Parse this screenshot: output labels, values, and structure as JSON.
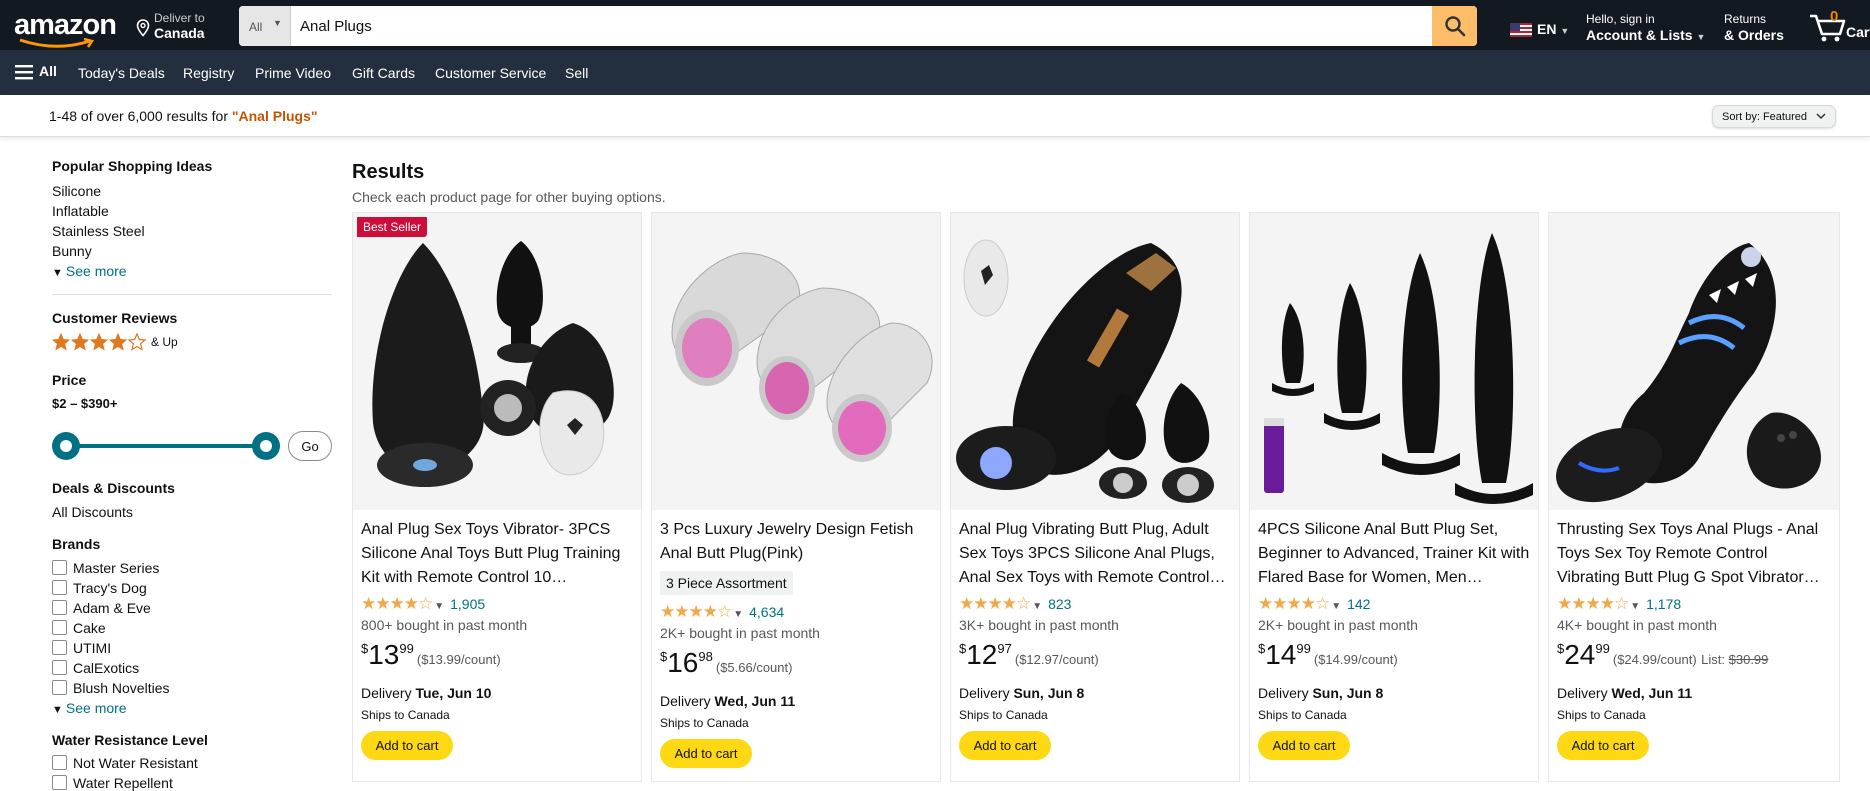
{
  "header": {
    "deliver_line1": "Deliver to",
    "deliver_line2": "Canada",
    "search_category": "All",
    "search_query": "Anal Plugs",
    "language": "EN",
    "account_line1": "Hello, sign in",
    "account_line2": "Account & Lists",
    "orders_line1": "Returns",
    "orders_line2": "& Orders",
    "cart_count": "0",
    "cart_label": "Cart"
  },
  "subnav": {
    "all_label": "All",
    "items": [
      "Today's Deals",
      "Registry",
      "Prime Video",
      "Gift Cards",
      "Customer Service",
      "Sell"
    ]
  },
  "results_bar": {
    "count_text": "1-48 of over 6,000 results for ",
    "query": "\"Anal Plugs\"",
    "sort_label": "Sort by:  Featured"
  },
  "sidebar": {
    "popular_heading": "Popular Shopping Ideas",
    "popular_items": [
      "Silicone",
      "Inflatable",
      "Stainless Steel",
      "Bunny"
    ],
    "see_more": "See more",
    "reviews_heading": "Customer Reviews",
    "reviews_stars": 4,
    "reviews_up": "& Up",
    "price_heading": "Price",
    "price_range": "$2 – $390+",
    "go_label": "Go",
    "deals_heading": "Deals & Discounts",
    "deals_item": "All Discounts",
    "brands_heading": "Brands",
    "brands": [
      "Master Series",
      "Tracy's Dog",
      "Adam & Eve",
      "Cake",
      "UTIMI",
      "CalExotics",
      "Blush Novelties"
    ],
    "brands_see_more": "See more",
    "water_heading": "Water Resistance Level",
    "water_items": [
      "Not Water Resistant",
      "Water Repellent"
    ]
  },
  "main": {
    "results_heading": "Results",
    "results_sub": "Check each product page for other buying options."
  },
  "products": [
    {
      "badge": "Best Seller",
      "title": "Anal Plug Sex Toys Vibrator- 3PCS Silicone Anal Toys Butt Plug Training Kit with Remote Control 10…",
      "rating_stars": "★★★★☆",
      "rating_count": "1,905",
      "bought": "800+ bought in past month",
      "price_whole": "13",
      "price_frac": "99",
      "unit_price": "($13.99/count)",
      "delivery_label": "Delivery ",
      "delivery_date": "Tue, Jun 10",
      "ships": "Ships to Canada",
      "add_to_cart": "Add to cart"
    },
    {
      "title": "3 Pcs Luxury Jewelry Design Fetish Anal Butt Plug(Pink)",
      "variant": "3 Piece Assortment",
      "rating_stars": "★★★★☆",
      "rating_count": "4,634",
      "bought": "2K+ bought in past month",
      "price_whole": "16",
      "price_frac": "98",
      "unit_price": "($5.66/count)",
      "delivery_label": "Delivery ",
      "delivery_date": "Wed, Jun 11",
      "ships": "Ships to Canada",
      "add_to_cart": "Add to cart"
    },
    {
      "title": "Anal Plug Vibrating Butt Plug, Adult Sex Toys 3PCS Silicone Anal Plugs, Anal Sex Toys with Remote Control…",
      "rating_stars": "★★★★☆",
      "rating_count": "823",
      "bought": "3K+ bought in past month",
      "price_whole": "12",
      "price_frac": "97",
      "unit_price": "($12.97/count)",
      "delivery_label": "Delivery ",
      "delivery_date": "Sun, Jun 8",
      "ships": "Ships to Canada",
      "add_to_cart": "Add to cart"
    },
    {
      "title": "4PCS Silicone Anal Butt Plug Set, Beginner to Advanced, Trainer Kit with Flared Base for Women, Men…",
      "rating_stars": "★★★★☆",
      "rating_count": "142",
      "bought": "2K+ bought in past month",
      "price_whole": "14",
      "price_frac": "99",
      "unit_price": "($14.99/count)",
      "delivery_label": "Delivery ",
      "delivery_date": "Sun, Jun 8",
      "ships": "Ships to Canada",
      "add_to_cart": "Add to cart"
    },
    {
      "title": "Thrusting Sex Toys Anal Plugs - Anal Toys Sex Toy Remote Control Vibrating Butt Plug G Spot Vibrator…",
      "rating_stars": "★★★★☆",
      "rating_count": "1,178",
      "bought": "4K+ bought in past month",
      "price_whole": "24",
      "price_frac": "99",
      "unit_price": "($24.99/count)",
      "list_label": "List: ",
      "list_price": "$30.99",
      "delivery_label": "Delivery ",
      "delivery_date": "Wed, Jun 11",
      "ships": "Ships to Canada",
      "add_to_cart": "Add to cart"
    }
  ],
  "colors": {
    "nav_top": "#131921",
    "nav_sub": "#232f3e",
    "search_button": "#febd69",
    "add_to_cart": "#ffd814",
    "star": "#f3a847",
    "link": "#007185",
    "query_accent": "#c45500",
    "badge": "#cc0c39"
  }
}
